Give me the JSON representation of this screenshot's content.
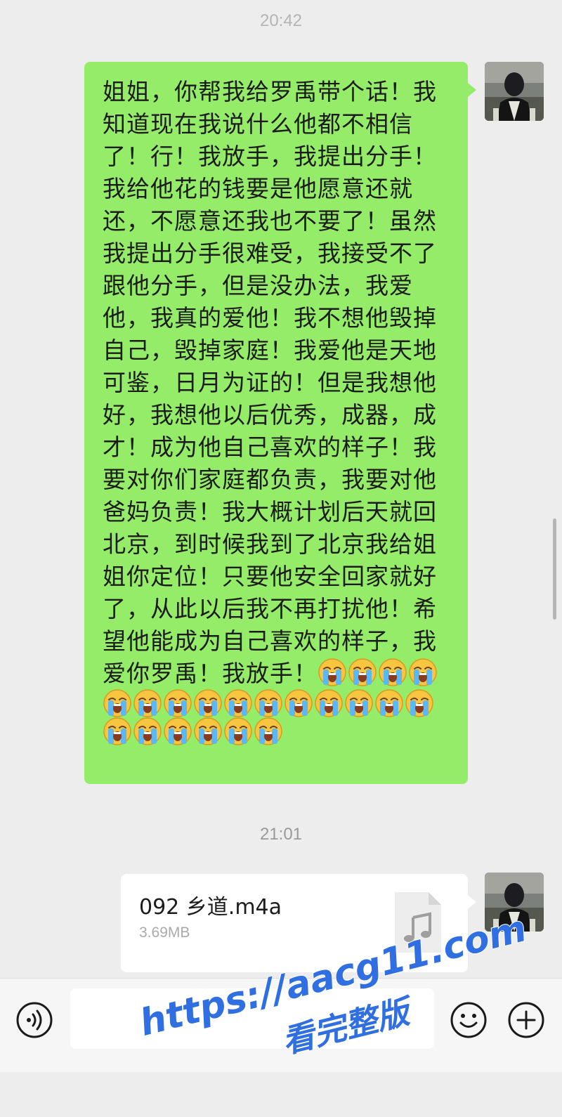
{
  "chat": {
    "timestamp_top": "20:42",
    "timestamp_mid": "21:01",
    "message": {
      "text": "姐姐，你帮我给罗禹带个话！我知道现在我说什么他都不相信了！行！我放手，我提出分手！我给他花的钱要是他愿意还就还，不愿意还我也不要了！虽然我提出分手很难受，我接受不了跟他分手，但是没办法，我爱他，我真的爱他！我不想他毁掉自己，毁掉家庭！我爱他是天地可鉴，日月为证的！但是我想他好，我想他以后优秀，成器，成才！成为他自己喜欢的样子！我要对你们家庭都负责，我要对他爸妈负责！我大概计划后天就回北京，到时候我到了北京我给姐姐你定位！只要他安全回家就好了，从此以后我不再打扰他！希望他能成为自己喜欢的样子，我爱你罗禹！我放手！",
      "emoji_name": "crying-face",
      "emoji_count": 21
    },
    "file_message": {
      "file_name": "092 乡道.m4a",
      "file_size": "3.69MB",
      "icon": "music-note-file-icon"
    }
  },
  "input_bar": {
    "placeholder": "",
    "voice_icon": "voice-icon",
    "emoji_icon": "smiley-icon",
    "plus_icon": "plus-icon"
  },
  "watermark": {
    "url": "https://aacg11.com",
    "text": "看完整版"
  },
  "colors": {
    "background": "#ededed",
    "sent_bubble": "#95ec69",
    "file_bubble": "#ffffff",
    "watermark": "#2f6fe2"
  }
}
